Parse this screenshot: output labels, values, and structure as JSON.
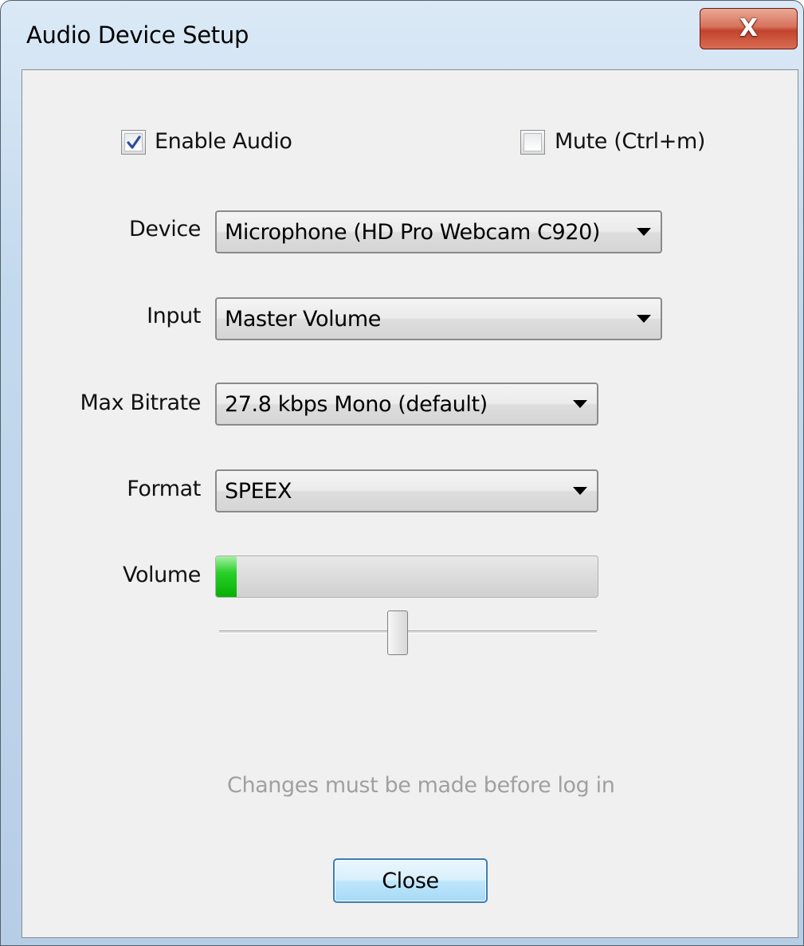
{
  "window": {
    "title": "Audio Device Setup",
    "close_glyph": "X"
  },
  "options": {
    "enable_audio": {
      "label": "Enable Audio",
      "checked": true
    },
    "mute": {
      "label": "Mute (Ctrl+m)",
      "checked": false
    }
  },
  "fields": {
    "device": {
      "label": "Device",
      "value": "Microphone (HD Pro Webcam C920)"
    },
    "input": {
      "label": "Input",
      "value": "Master Volume"
    },
    "max_bitrate": {
      "label": "Max Bitrate",
      "value": "27.8 kbps Mono (default)"
    },
    "format": {
      "label": "Format",
      "value": "SPEEX"
    },
    "volume": {
      "label": "Volume",
      "meter_level": 0.055,
      "slider_value": 0.47
    }
  },
  "note": "Changes must be made before log in",
  "buttons": {
    "close": "Close"
  },
  "colors": {
    "meter_green": "#06b006",
    "check_blue": "#2d4c9c",
    "note_gray": "#a0a0a0",
    "button_border": "#3c7fb1"
  },
  "icons": {
    "titlebar_close": "close-icon",
    "dropdown": "chevron-down-icon",
    "check": "check-icon"
  }
}
